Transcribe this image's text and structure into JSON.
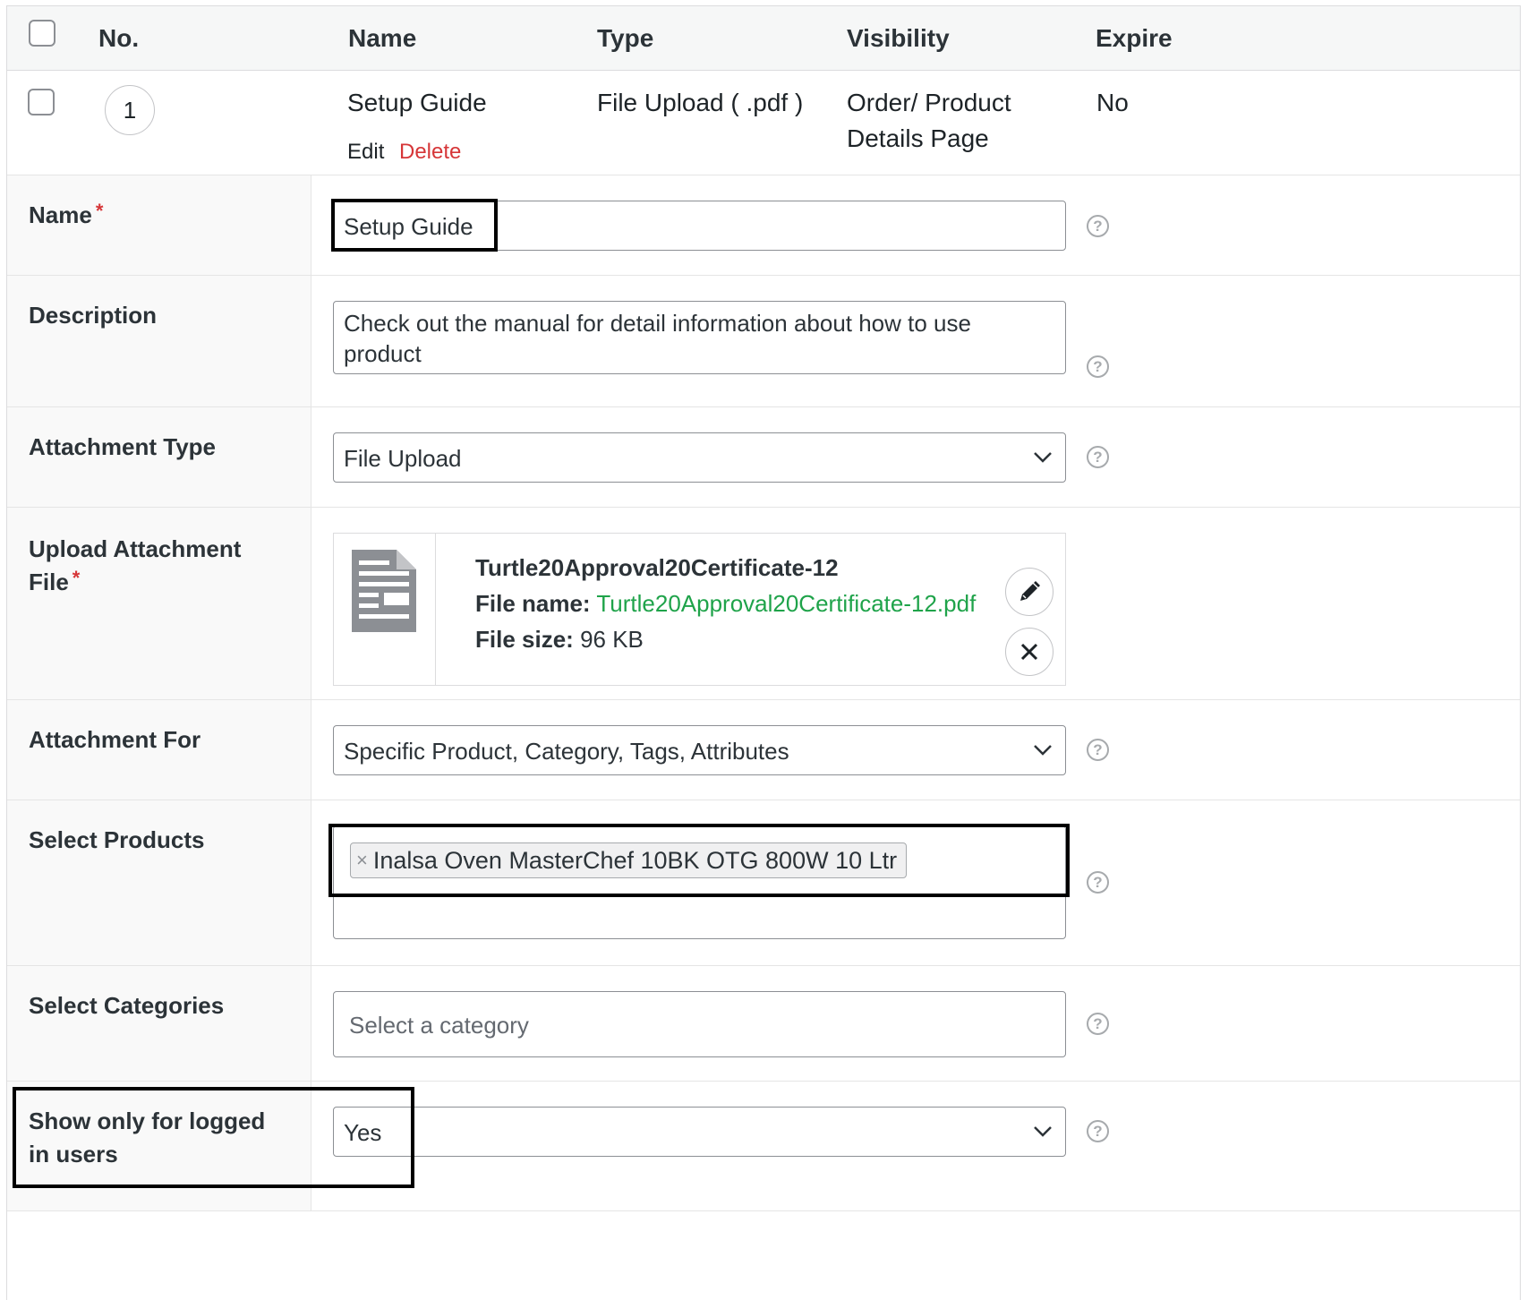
{
  "table": {
    "headers": {
      "no": "No.",
      "name": "Name",
      "type": "Type",
      "visibility": "Visibility",
      "expire": "Expire"
    },
    "row": {
      "number": "1",
      "name": "Setup Guide",
      "edit": "Edit",
      "delete": "Delete",
      "type": "File Upload ( .pdf )",
      "visibility_line1": "Order/ Product",
      "visibility_line2": "Details Page",
      "expire": "No"
    }
  },
  "form": {
    "required_mark": "*",
    "help_glyph": "?",
    "name": {
      "label": "Name",
      "value": "Setup Guide"
    },
    "description": {
      "label": "Description",
      "value_line1": "Check out the manual for detail information about how to use",
      "value_line2": "product"
    },
    "attachment_type": {
      "label": "Attachment Type",
      "value": "File Upload"
    },
    "upload": {
      "label_line1": "Upload Attachment",
      "label_line2": "File",
      "file_title": "Turtle20Approval20Certificate-12",
      "file_name_label": "File name:",
      "file_name": "Turtle20Approval20Certificate-12.pdf",
      "file_size_label": "File size:",
      "file_size": "96 KB"
    },
    "attachment_for": {
      "label": "Attachment For",
      "value": "Specific Product, Category, Tags, Attributes"
    },
    "select_products": {
      "label": "Select Products",
      "remove_glyph": "×",
      "tags": [
        "Inalsa Oven MasterChef 10BK OTG 800W 10 Ltr"
      ]
    },
    "select_categories": {
      "label": "Select Categories",
      "placeholder": "Select a category"
    },
    "logged_in": {
      "label_line1": "Show only for logged",
      "label_line2": "in users",
      "value": "Yes"
    }
  },
  "colors": {
    "required": "#d63638",
    "delete_link": "#d63638",
    "file_link": "#1fa34a",
    "highlight_border": "#000000"
  }
}
